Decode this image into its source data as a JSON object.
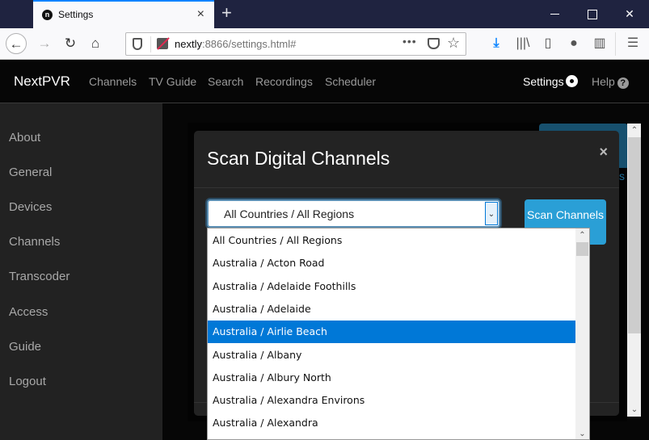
{
  "browser": {
    "tab_title": "Settings",
    "tab_favicon_letter": "n",
    "tab_close": "×",
    "new_tab": "+",
    "url_host": "nextly",
    "url_rest": ":8866/settings.html#",
    "more_label": "•••",
    "back_glyph": "←",
    "forward_glyph": "→",
    "reload_glyph": "↻",
    "home_glyph": "⌂",
    "star_glyph": "☆",
    "download_glyph": "⤓",
    "library_glyph": "|||\\",
    "sidebar_glyph": "▯",
    "account_glyph": "●",
    "extensions_glyph": "▥",
    "menu_glyph": "☰",
    "win_close_glyph": "✕"
  },
  "app_nav": {
    "brand": "NextPVR",
    "links": [
      "Channels",
      "TV Guide",
      "Search",
      "Recordings",
      "Scheduler"
    ],
    "settings": "Settings",
    "help": "Help",
    "help_icon_glyph": "?"
  },
  "sidebar": {
    "items": [
      "About",
      "General",
      "Devices",
      "Channels",
      "Transcoder",
      "Access",
      "Guide",
      "Logout"
    ]
  },
  "background": {
    "partial_button_text": "s"
  },
  "modal": {
    "title": "Scan Digital Channels",
    "close_glyph": "×",
    "select_value": "All Countries / All Regions",
    "select_arrow": "⌄",
    "scan_button_label": "Scan Channels"
  },
  "dropdown": {
    "selected_index": 4,
    "options": [
      "All Countries / All Regions",
      "Australia / Acton Road",
      "Australia / Adelaide Foothills",
      "Australia / Adelaide",
      "Australia / Airlie Beach",
      "Australia / Albany",
      "Australia / Albury North",
      "Australia / Alexandra Environs",
      "Australia / Alexandra"
    ],
    "scroll_up_glyph": "⌃",
    "scroll_down_glyph": "⌄"
  },
  "colors": {
    "accent": "#2a9fd6",
    "selection": "#0078d7",
    "browser_accent": "#0a84ff"
  }
}
